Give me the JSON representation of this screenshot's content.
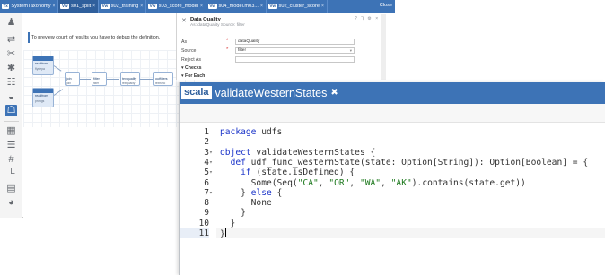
{
  "background_window": {
    "tabs": [
      {
        "badge": "Tx",
        "label": "SystemTaxonomy",
        "active": false
      },
      {
        "badge": "Vw",
        "label": "s01_split",
        "active": true
      },
      {
        "badge": "Vw",
        "label": "s02_training",
        "active": false
      },
      {
        "badge": "Vw",
        "label": "s03_score_model",
        "active": false
      },
      {
        "badge": "Vw",
        "label": "s04_model.m03...",
        "active": false
      },
      {
        "badge": "Vw",
        "label": "s02_cluster_score",
        "active": false
      }
    ],
    "tab_close_glyph": "×",
    "tabbar_close_label": "Close",
    "message": "To preview count of results you have to debug the definition.",
    "graph_nodes": [
      {
        "label": "readfrom",
        "sub": "flydepa"
      },
      {
        "label": "join",
        "sub": "join"
      },
      {
        "label": "filter",
        "sub": "filter"
      },
      {
        "label": "textquality",
        "sub": "textquality"
      },
      {
        "label": "outfilters",
        "sub": "textfunc"
      },
      {
        "label": "readfrom",
        "sub": "prongs"
      }
    ]
  },
  "sidebar": {
    "icons": [
      {
        "name": "users-icon",
        "glyph": "♟"
      },
      {
        "name": "transfer-icon",
        "glyph": "⇄"
      },
      {
        "name": "attach-icon",
        "glyph": "✂"
      },
      {
        "name": "asterisk-icon",
        "glyph": "✱"
      },
      {
        "name": "settings-sliders-icon",
        "glyph": "☷"
      },
      {
        "name": "monitor-icon",
        "glyph": "◒"
      },
      {
        "name": "hierarchy-icon",
        "glyph": "☖"
      },
      {
        "name": "grid-icon",
        "glyph": "▦"
      },
      {
        "name": "database-icon",
        "glyph": "☰"
      },
      {
        "name": "hash-icon",
        "glyph": "#"
      },
      {
        "name": "tree-icon",
        "glyph": "└"
      },
      {
        "name": "storage-icon",
        "glyph": "▤"
      },
      {
        "name": "globe-icon",
        "glyph": "◕"
      }
    ]
  },
  "data_quality_panel": {
    "title": "Data Quality",
    "subtitle": "As: dataQuality Source: filter",
    "fields": [
      {
        "label": "As",
        "required": true,
        "value": "dataQuality",
        "has_dropdown": false
      },
      {
        "label": "Source",
        "required": true,
        "value": "filter",
        "has_dropdown": true
      },
      {
        "label": "Reject As",
        "required": false,
        "value": "",
        "has_dropdown": false
      }
    ],
    "required_marker": "*",
    "dropdown_caret": "▾",
    "sections": [
      "▾ Checks",
      "▾ For Each"
    ],
    "header_icons": "? ⅂ ⚙ ×"
  },
  "editor": {
    "language_badge": "scala",
    "title": "validateWesternStates",
    "close_glyph": "✖",
    "current_line": 11,
    "fold_glyph": "▾",
    "lines": [
      {
        "num": "1",
        "fold": false,
        "tokens": [
          {
            "t": "package",
            "c": "kw"
          },
          {
            "t": " udfs",
            "c": ""
          }
        ]
      },
      {
        "num": "2",
        "fold": false,
        "tokens": []
      },
      {
        "num": "3",
        "fold": true,
        "tokens": [
          {
            "t": "object",
            "c": "kw"
          },
          {
            "t": " validateWesternStates {",
            "c": ""
          }
        ]
      },
      {
        "num": "4",
        "fold": true,
        "tokens": [
          {
            "t": "  ",
            "c": ""
          },
          {
            "t": "def",
            "c": "kw"
          },
          {
            "t": " udf_func_westernState(state: Option[String]): Option[Boolean] = {",
            "c": ""
          }
        ]
      },
      {
        "num": "5",
        "fold": true,
        "tokens": [
          {
            "t": "    ",
            "c": ""
          },
          {
            "t": "if",
            "c": "kw"
          },
          {
            "t": " (state.isDefined) {",
            "c": ""
          }
        ]
      },
      {
        "num": "6",
        "fold": false,
        "tokens": [
          {
            "t": "      Some(Seq(",
            "c": ""
          },
          {
            "t": "\"CA\"",
            "c": "str"
          },
          {
            "t": ", ",
            "c": ""
          },
          {
            "t": "\"OR\"",
            "c": "str"
          },
          {
            "t": ", ",
            "c": ""
          },
          {
            "t": "\"WA\"",
            "c": "str"
          },
          {
            "t": ", ",
            "c": ""
          },
          {
            "t": "\"AK\"",
            "c": "str"
          },
          {
            "t": ").contains(state.get))",
            "c": ""
          }
        ]
      },
      {
        "num": "7",
        "fold": true,
        "tokens": [
          {
            "t": "    } ",
            "c": ""
          },
          {
            "t": "else",
            "c": "kw"
          },
          {
            "t": " {",
            "c": ""
          }
        ]
      },
      {
        "num": "8",
        "fold": false,
        "tokens": [
          {
            "t": "      None",
            "c": ""
          }
        ]
      },
      {
        "num": "9",
        "fold": false,
        "tokens": [
          {
            "t": "    }",
            "c": ""
          }
        ]
      },
      {
        "num": "10",
        "fold": false,
        "tokens": [
          {
            "t": "  }",
            "c": ""
          }
        ]
      },
      {
        "num": "11",
        "fold": false,
        "tokens": [
          {
            "t": "}",
            "c": ""
          }
        ]
      }
    ]
  }
}
